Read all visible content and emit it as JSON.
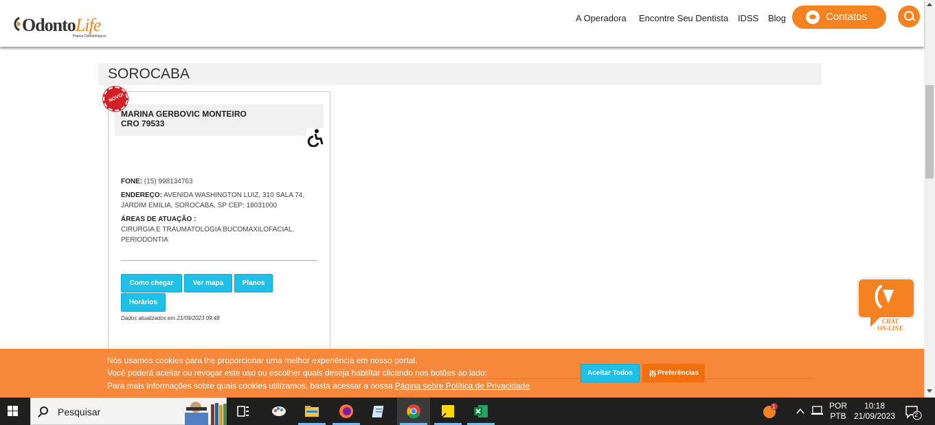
{
  "header": {
    "logo": {
      "brand_main": "Odonto",
      "brand_accent": "Life",
      "tagline": "Planos Odontológicos"
    },
    "nav": [
      {
        "label": "A Operadora"
      },
      {
        "label": "Encontre Seu Dentista"
      },
      {
        "label": "IDSS"
      },
      {
        "label": "Blog"
      }
    ],
    "contact_label": "Contatos",
    "accent_color": "#f58220"
  },
  "section": {
    "city": "SOROCABA"
  },
  "dentist": {
    "badge": "NOVO!",
    "name": "MARINA GERBOVIC MONTEIRO",
    "cro": "CRO 79533",
    "accessibility_icon": "wheelchair-icon",
    "phone_label": "FONE:",
    "phone": "(15) 998134763",
    "address_label": "ENDEREÇO:",
    "address_line1": "AVENIDA WASHINGTON LUIZ, 310 SALA 74,",
    "address_line2": "JARDIM EMILIA, SOROCABA, SP CEP: 18031000",
    "areas_label": "ÁREAS DE ATUAÇÃO :",
    "areas_line1": "CIRURGIA E TRAUMATOLOGIA BUCOMAXILOFACIAL,",
    "areas_line2": "PERIODONTIA",
    "buttons": {
      "directions": "Como chegar",
      "map": "Ver mapa",
      "plans": "Planos",
      "hours": "Horários"
    },
    "updated": "Dados atualizados em 21/09/2023 09:48"
  },
  "chat": {
    "line1": "CHAT",
    "line2": "ON-LINE"
  },
  "cookie": {
    "line1": "Nós usamos cookies para lhe proporcionar uma melhor experiência em nosso portal.",
    "line2": "Você poderá aceitar ou revogar este uso ou escolher quais deseja habilitar clicando nos botões ao lado:",
    "line3_prefix": "Para mais informações sobre quais cookies utilizamos, basta acessar a nossa ",
    "line3_link": "Página sobre Política de Privacidade",
    "accept_label": "Aceitar Todos",
    "prefs_label": "Preferências"
  },
  "taskbar": {
    "search_placeholder": "Pesquisar",
    "apps": [
      "task-view",
      "paint",
      "file-explorer",
      "firefox",
      "notepad",
      "chrome",
      "sticky-notes",
      "excel"
    ],
    "notification_badge": "1",
    "language_line1": "POR",
    "language_line2": "PTB",
    "time": "10:18",
    "date": "21/09/2023",
    "action_center_count": "2"
  }
}
